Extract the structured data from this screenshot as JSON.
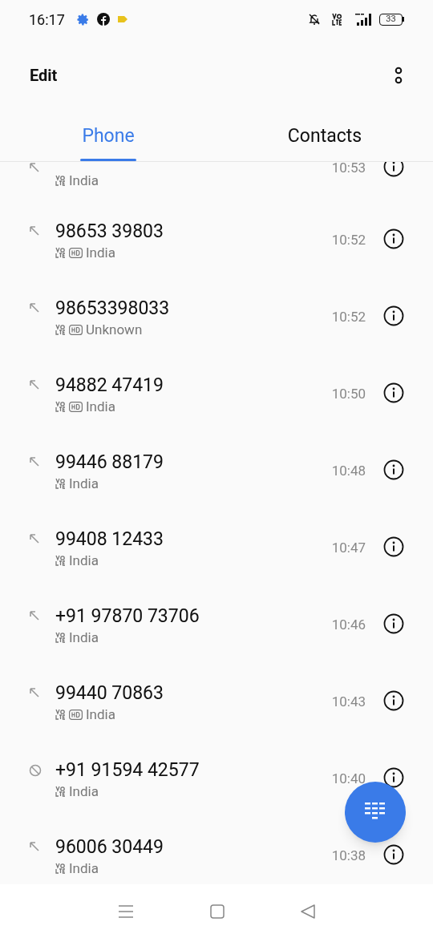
{
  "status_bar": {
    "time": "16:17",
    "battery": "33"
  },
  "toolbar": {
    "edit": "Edit"
  },
  "tabs": [
    {
      "label": "Phone",
      "selected": true
    },
    {
      "label": "Contacts",
      "selected": false
    }
  ],
  "calls": [
    {
      "kind": "outgoing",
      "hd": false,
      "location": "India",
      "time": "10:53"
    },
    {
      "kind": "outgoing",
      "number": "98653 39803",
      "hd": true,
      "location": "India",
      "time": "10:52"
    },
    {
      "kind": "outgoing",
      "number": "98653398033",
      "hd": true,
      "location": "Unknown",
      "time": "10:52"
    },
    {
      "kind": "outgoing",
      "number": "94882 47419",
      "hd": true,
      "location": "India",
      "time": "10:50"
    },
    {
      "kind": "outgoing",
      "number": "99446 88179",
      "hd": false,
      "location": "India",
      "time": "10:48"
    },
    {
      "kind": "outgoing",
      "number": "99408 12433",
      "hd": false,
      "location": "India",
      "time": "10:47"
    },
    {
      "kind": "outgoing",
      "number": "+91 97870 73706",
      "hd": false,
      "location": "India",
      "time": "10:46"
    },
    {
      "kind": "outgoing",
      "number": "99440 70863",
      "hd": true,
      "location": "India",
      "time": "10:43"
    },
    {
      "kind": "blocked",
      "number": "+91 91594 42577",
      "hd": false,
      "location": "India",
      "time": "10:40"
    },
    {
      "kind": "outgoing",
      "number": "96006 30449",
      "hd": false,
      "location": "India",
      "time": "10:38"
    }
  ]
}
